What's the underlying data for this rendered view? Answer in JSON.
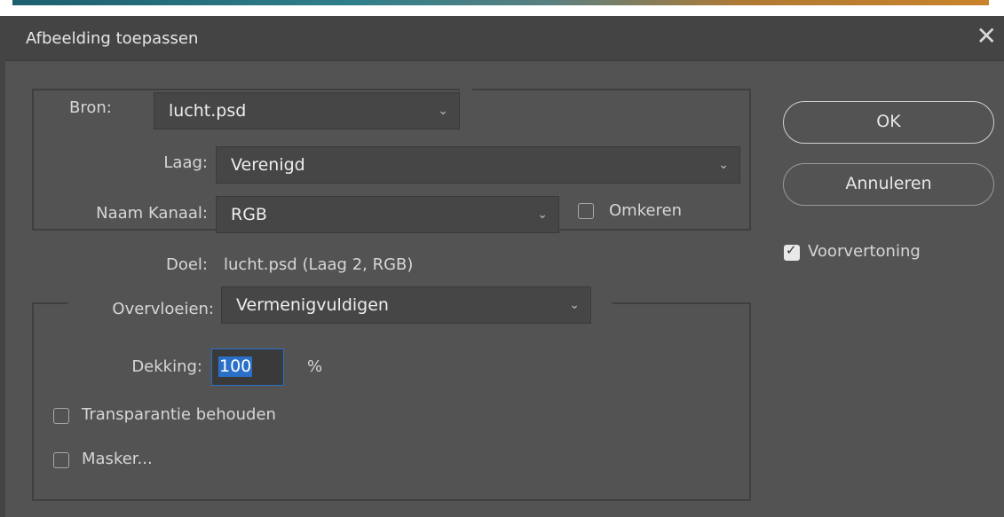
{
  "window": {
    "title": "Afbeelding toepassen",
    "close_icon": "close-icon"
  },
  "source": {
    "bron_label": "Bron:",
    "bron_value": "lucht.psd",
    "laag_label": "Laag:",
    "laag_value": "Verenigd",
    "kanaal_label": "Naam Kanaal:",
    "kanaal_value": "RGB",
    "omkeren_label": "Omkeren",
    "omkeren_checked": false
  },
  "target": {
    "doel_label": "Doel:",
    "doel_value": "lucht.psd (Laag 2, RGB)"
  },
  "blending": {
    "overvloeien_label": "Overvloeien:",
    "overvloeien_value": "Vermenigvuldigen",
    "dekking_label": "Dekking:",
    "dekking_value": "100",
    "dekking_unit": "%",
    "transparantie_label": "Transparantie behouden",
    "transparantie_checked": false,
    "masker_label": "Masker...",
    "masker_checked": false
  },
  "buttons": {
    "ok_label": "OK",
    "cancel_label": "Annuleren"
  },
  "preview": {
    "label": "Voorvertoning",
    "checked": true
  },
  "colors": {
    "background": "#535353",
    "titlebar": "#444444",
    "accent": "#2a70c9"
  }
}
